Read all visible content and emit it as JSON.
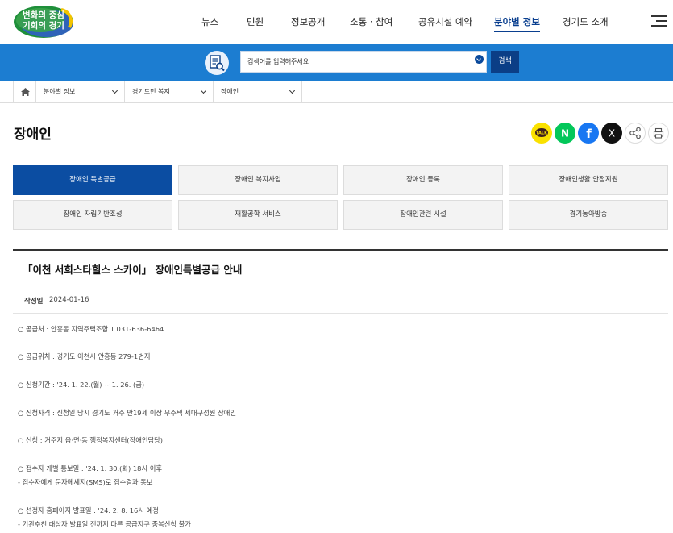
{
  "header": {
    "logo_line1": "변화의 중심",
    "logo_line2": "기회의 경기",
    "nav": [
      "뉴스",
      "민원",
      "정보공개",
      "소통 · 참여",
      "공유시설 예약",
      "분야별 정보",
      "경기도 소개"
    ],
    "active_nav": "분야별 정보"
  },
  "search": {
    "placeholder": "검색어를 입력해주세요",
    "button_label": "검색"
  },
  "breadcrumb": [
    "분야별 정보",
    "경기도민 복지",
    "장애인"
  ],
  "page": {
    "title": "장애인",
    "share_labels": {
      "kakaotalk": "TALK",
      "naver": "N",
      "facebook": "f",
      "x": "X"
    }
  },
  "tabs": [
    "장애인 특별공급",
    "장애인 복지사업",
    "장애인 등록",
    "장애인생활 안정지원",
    "장애인 자립기반조성",
    "재활공학 서비스",
    "장애인관련 시설",
    "경기농아방송"
  ],
  "active_tab": "장애인 특별공급",
  "notice": {
    "title": "「이천 서희스타힐스 스카이」 장애인특별공급 안내",
    "date_label": "작성일",
    "date": "2024-01-16",
    "lines": [
      "○ 공급처 : 안흥동 지역주택조합  T 031-636-6464",
      "○ 공급위치 : 경기도 이천시 안흥동 279-1번지",
      "○ 신청기간 : '24. 1. 22.(월) ~ 1. 26. (금)",
      "○ 신청자격 : 신청일 당시 경기도 거주 만19세 이상 무주택 세대구성원 장애인",
      "○ 신청 : 거주지 읍·면·동 행정복지센터(장애인담당)",
      "○ 접수자 개별 통보일 : '24. 1. 30.(화) 18시 이후",
      " - 접수자에게 문자메세지(SMS)로 접수결과 통보",
      "○ 선정자 홈페이지 발표일 : '24. 2. 8.  16시 예정",
      " - 기관추천 대상자 발표일 전까지 다른 공급지구 중복신청 불가"
    ]
  },
  "colors": {
    "brand_blue": "#1c7dd1",
    "dark_blue": "#0b4da2",
    "kakao": "#fae100",
    "naver": "#03c75a",
    "facebook": "#1877f2"
  }
}
